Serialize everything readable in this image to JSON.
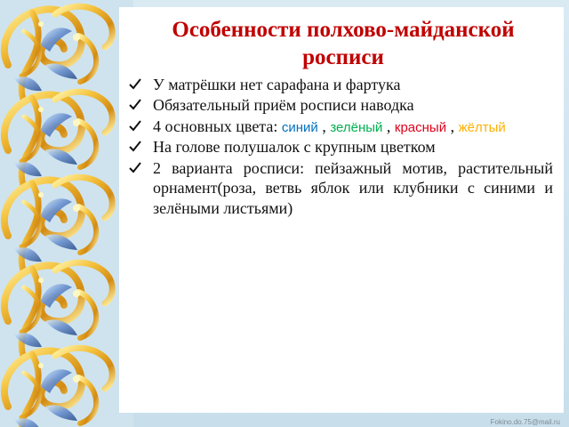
{
  "slide": {
    "title": "Особенности полхово-майданской росписи",
    "bullets": [
      "У матрёшки нет сарафана и фартука",
      "Обязательный приём росписи наводка",
      {
        "prefix": "4 основных цвета: ",
        "colors": [
          {
            "text": "синий",
            "color": "#0070c0"
          },
          {
            "text": "зелёный",
            "color": "#00b050"
          },
          {
            "text": "красный",
            "color": "#e0001b"
          },
          {
            "text": "жёлтый",
            "color": "#ffb000"
          }
        ],
        "separator": ", "
      },
      "На голове полушалок с крупным цветком",
      "2 варианта росписи: пейзажный мотив, растительный орнамент(роза, ветвь яблок или клубники с синими и зелёными листьями)"
    ],
    "watermark": "Fokino.do.75@mail.ru"
  },
  "icons": {
    "bullet": "checkmark-icon",
    "ornament": "golden-scroll-ornament"
  },
  "colors": {
    "title": "#c00000",
    "ornament_gold": "#e0a21a",
    "ornament_light": "#fff1a8",
    "ornament_blue": "#4b6fa8"
  }
}
